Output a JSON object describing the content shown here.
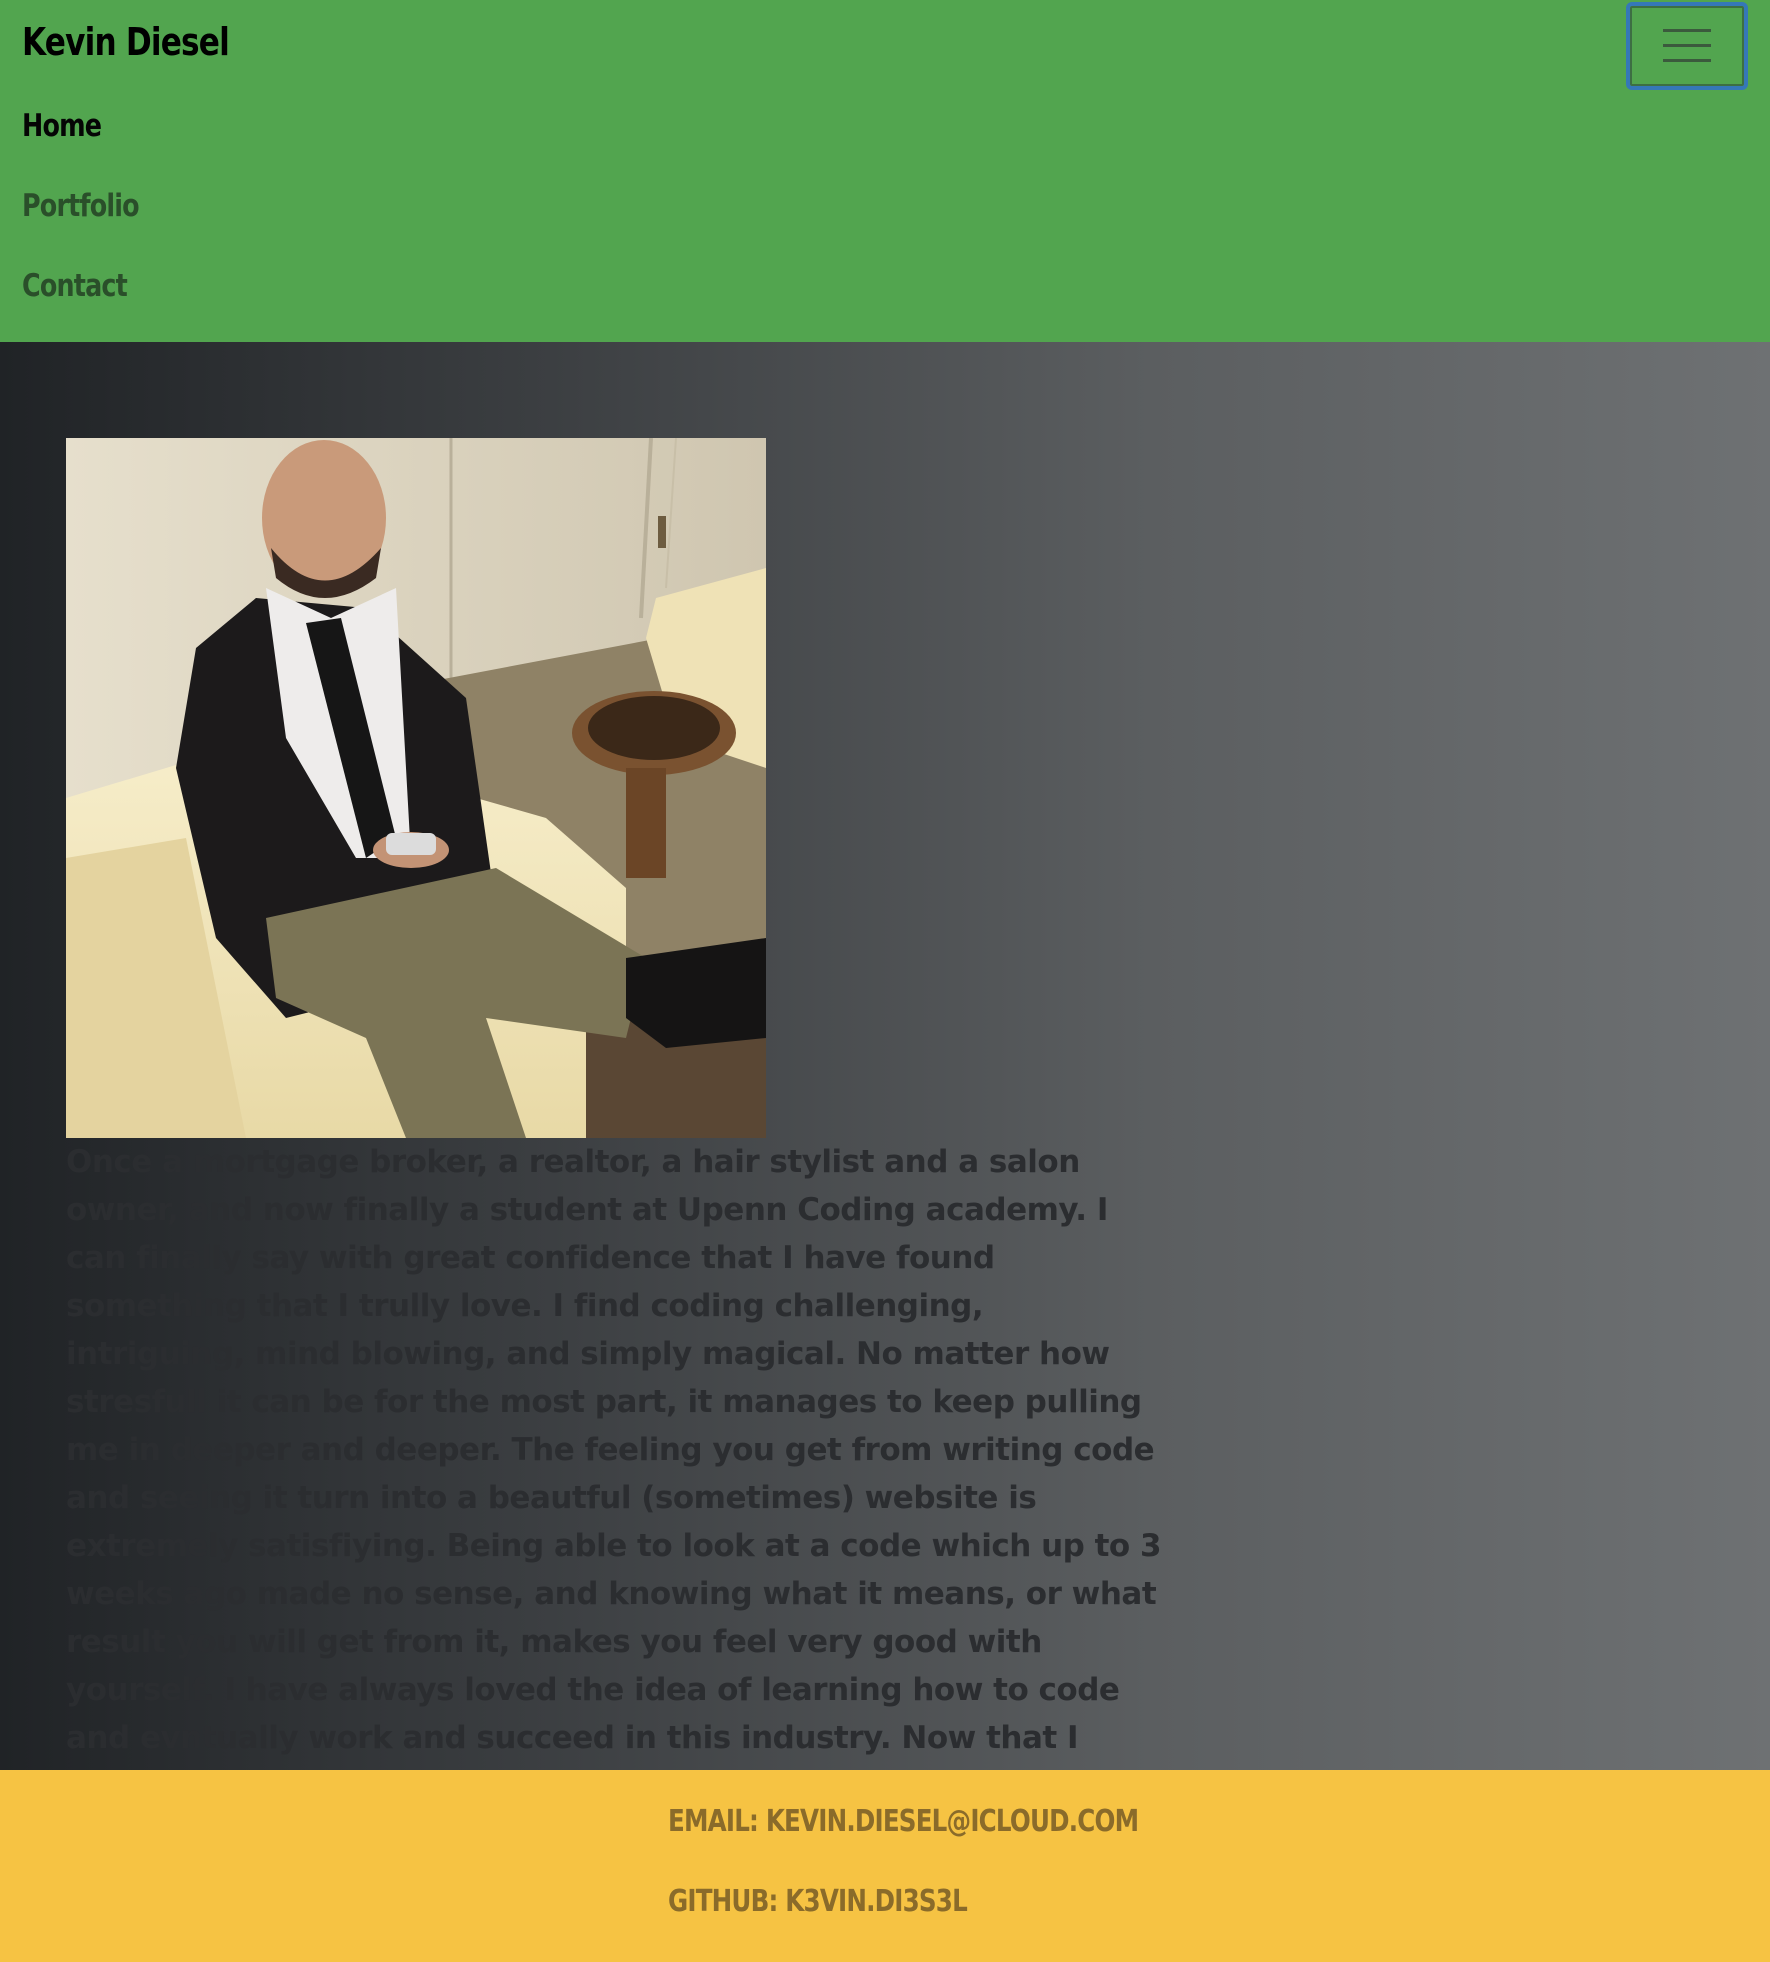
{
  "header": {
    "brand": "Kevin Diesel",
    "nav": [
      {
        "label": "Home",
        "active": true
      },
      {
        "label": "Portfolio",
        "active": false
      },
      {
        "label": "Contact",
        "active": false
      }
    ],
    "toggler_icon": "hamburger-menu-icon"
  },
  "main": {
    "photo_alt": "Kevin Diesel",
    "bio": "Once a mortgage broker, a realtor, a hair stylist and a salon owner, and now finally a student at Upenn Coding academy. I can finally say with great confidence that I have found something that I trully love. I find coding challenging, intriguing, mind blowing, and simply magical. No matter how stresfull it can be for the most part, it manages to keep pulling me in deeper and deeper. The feeling you get from writing code and seeing it turn into a beautful (sometimes) website is extremely satisfiying. Being able to look at a code which up to 3 weeks ago made no sense, and knowing what it means, or what result you will get from it, makes you feel very good with yourself. I have always loved the idea of learning how to code and evntually work and succeed in this industry. Now that I finally have this chance I am willing to do whatever it takes to make it happen. Looking forward to"
  },
  "footer": {
    "email": "EMAIL: KEVIN.DIESEL@ICLOUD.COM",
    "github": "GITHUB: K3VIN.DI3S3L"
  },
  "colors": {
    "navbar": "#52a54f",
    "footer": "#f6c343",
    "toggler_border": "#3578b8"
  }
}
